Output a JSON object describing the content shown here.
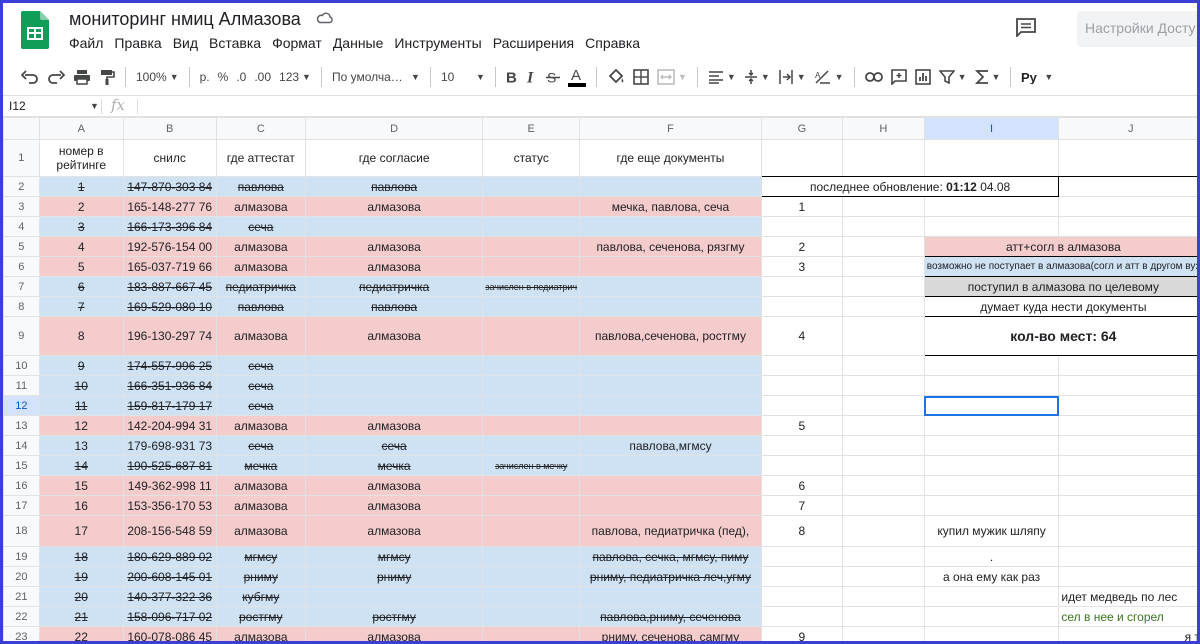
{
  "app": {
    "title": "мониторинг нмиц Алмазова",
    "settings_label": "Настройки Досту",
    "menu": [
      "Файл",
      "Правка",
      "Вид",
      "Вставка",
      "Формат",
      "Данные",
      "Инструменты",
      "Расширения",
      "Справка"
    ]
  },
  "toolbar": {
    "zoom": "100%",
    "currency": "р.",
    "percent": "%",
    "dec_decrease": ".0",
    "dec_increase": ".00",
    "format_more": "123",
    "font": "По умолча…",
    "font_size": "10",
    "accent_color": "#000000"
  },
  "formula_bar": {
    "name_box": "I12",
    "fx": "fx",
    "value": ""
  },
  "columns": [
    "A",
    "B",
    "C",
    "D",
    "E",
    "F",
    "G",
    "H",
    "I",
    "J"
  ],
  "selected": {
    "column": "I",
    "row": "12"
  },
  "header_row": {
    "num": "1",
    "A": "номер в рейтинге",
    "B": "снилс",
    "C": "где аттестат",
    "D": "где согласие",
    "E": "статус",
    "F": "где еще документы"
  },
  "rows": [
    {
      "num": "2",
      "A": "1",
      "B": "147-870-303 84",
      "C": "павлова",
      "D": "павлова",
      "E": "",
      "F": "",
      "G": "",
      "color": "blue",
      "strike": true
    },
    {
      "num": "3",
      "A": "2",
      "B": "165-148-277 76",
      "C": "алмазова",
      "D": "алмазова",
      "E": "",
      "F": "мечка, павлова, сеча",
      "G": "1",
      "color": "pink",
      "strike": false
    },
    {
      "num": "4",
      "A": "3",
      "B": "166-173-396 84",
      "C": "сеча",
      "D": "",
      "E": "",
      "F": "",
      "G": "",
      "color": "blue",
      "strike": true
    },
    {
      "num": "5",
      "A": "4",
      "B": "192-576-154 00",
      "C": "алмазова",
      "D": "алмазова",
      "E": "",
      "F": "павлова, сеченова, рязгму",
      "G": "2",
      "color": "pink",
      "strike": false
    },
    {
      "num": "6",
      "A": "5",
      "B": "165-037-719 66",
      "C": "алмазова",
      "D": "алмазова",
      "E": "",
      "F": "",
      "G": "3",
      "color": "pink",
      "strike": false
    },
    {
      "num": "7",
      "A": "6",
      "B": "183-887-667 45",
      "C": "педиатричка",
      "D": "педиатричка",
      "E": "зачислен в педиатрич",
      "F": "",
      "G": "",
      "color": "blue",
      "strike": true
    },
    {
      "num": "8",
      "A": "7",
      "B": "169-529-080 10",
      "C": "павлова",
      "D": "павлова",
      "E": "",
      "F": "",
      "G": "",
      "color": "blue",
      "strike": true
    },
    {
      "num": "9",
      "A": "8",
      "B": "196-130-297 74",
      "C": "алмазова",
      "D": "алмазова",
      "E": "",
      "F": "павлова,сеченова, ростгму",
      "G": "4",
      "color": "pink",
      "strike": false
    },
    {
      "num": "10",
      "A": "9",
      "B": "174-557-996 25",
      "C": "сеча",
      "D": "",
      "E": "",
      "F": "",
      "G": "",
      "color": "blue",
      "strike": true
    },
    {
      "num": "11",
      "A": "10",
      "B": "166-351-936 84",
      "C": "сеча",
      "D": "",
      "E": "",
      "F": "",
      "G": "",
      "color": "blue",
      "strike": true
    },
    {
      "num": "12",
      "A": "11",
      "B": "159-817-179 17",
      "C": "сеча",
      "D": "",
      "E": "",
      "F": "",
      "G": "",
      "color": "blue",
      "strike": true
    },
    {
      "num": "13",
      "A": "12",
      "B": "142-204-994 31",
      "C": "алмазова",
      "D": "алмазова",
      "E": "",
      "F": "",
      "G": "5",
      "color": "pink",
      "strike": false
    },
    {
      "num": "14",
      "A": "13",
      "B": "179-698-931 73",
      "C": "сеча",
      "D": "сеча",
      "E": "",
      "F": "павлова,мгмсу",
      "G": "",
      "color": "blue",
      "strike": false,
      "strike_cd": true
    },
    {
      "num": "15",
      "A": "14",
      "B": "190-525-687 81",
      "C": "мечка",
      "D": "мечка",
      "E": "зачислен в мечку",
      "F": "",
      "G": "",
      "color": "blue",
      "strike": true
    },
    {
      "num": "16",
      "A": "15",
      "B": "149-362-998 11",
      "C": "алмазова",
      "D": "алмазова",
      "E": "",
      "F": "",
      "G": "6",
      "color": "pink",
      "strike": false
    },
    {
      "num": "17",
      "A": "16",
      "B": "153-356-170 53",
      "C": "алмазова",
      "D": "алмазова",
      "E": "",
      "F": "",
      "G": "7",
      "color": "pink",
      "strike": false
    },
    {
      "num": "18",
      "A": "17",
      "B": "208-156-548 59",
      "C": "алмазова",
      "D": "алмазова",
      "E": "",
      "F": "павлова, педиатричка (пед),",
      "G": "8",
      "color": "pink",
      "strike": false
    },
    {
      "num": "19",
      "A": "18",
      "B": "180-629-889 02",
      "C": "мгмсу",
      "D": "мгмсу",
      "E": "",
      "F": "павлова, сечка, мгмсу, пиму",
      "G": "",
      "color": "blue",
      "strike": true
    },
    {
      "num": "20",
      "A": "19",
      "B": "200-608-145 01",
      "C": "рниму",
      "D": "рниму",
      "E": "",
      "F": "рниму, педиатричка леч,угму",
      "G": "",
      "color": "blue",
      "strike": true
    },
    {
      "num": "21",
      "A": "20",
      "B": "140-377-322 36",
      "C": "кубгму",
      "D": "",
      "E": "",
      "F": "",
      "G": "",
      "color": "blue",
      "strike": true
    },
    {
      "num": "22",
      "A": "21",
      "B": "158-096-717 02",
      "C": "ростгму",
      "D": "ростгму",
      "E": "",
      "F": "павлова,рниму, сеченова",
      "G": "",
      "color": "blue",
      "strike": true
    },
    {
      "num": "23",
      "A": "22",
      "B": "160-078-086 45",
      "C": "алмазова",
      "D": "алмазова",
      "E": "",
      "F": "рниму, сеченова, самгму",
      "G": "9",
      "color": "pink",
      "strike": false
    }
  ],
  "side": {
    "last_update_prefix": "последнее обновление: ",
    "last_update_time": "01:12",
    "last_update_date": " 04.08",
    "legend_pink": "атт+согл в алмазова",
    "legend_blue": "возможно не поступает в алмазова(согл и атт в другом вуз",
    "legend_grey": "поступил в алмазова по целевому",
    "legend_white": "думает куда нести документы",
    "seats": "кол-во мест: 64",
    "poem_1": "купил мужик шляпу",
    "poem_2": ".",
    "poem_3": "а она ему как раз",
    "poem_4": "идет медведь по лес",
    "poem_5": "сел в нее и сгорел",
    "poem_6": "я т"
  },
  "colors": {
    "pink": "#f4cccc",
    "blue": "#cfe2f3",
    "grey": "#d9d9d9",
    "selection": "#1a73e8",
    "green_text": "#38761d",
    "frame": "#3c3fd6"
  }
}
